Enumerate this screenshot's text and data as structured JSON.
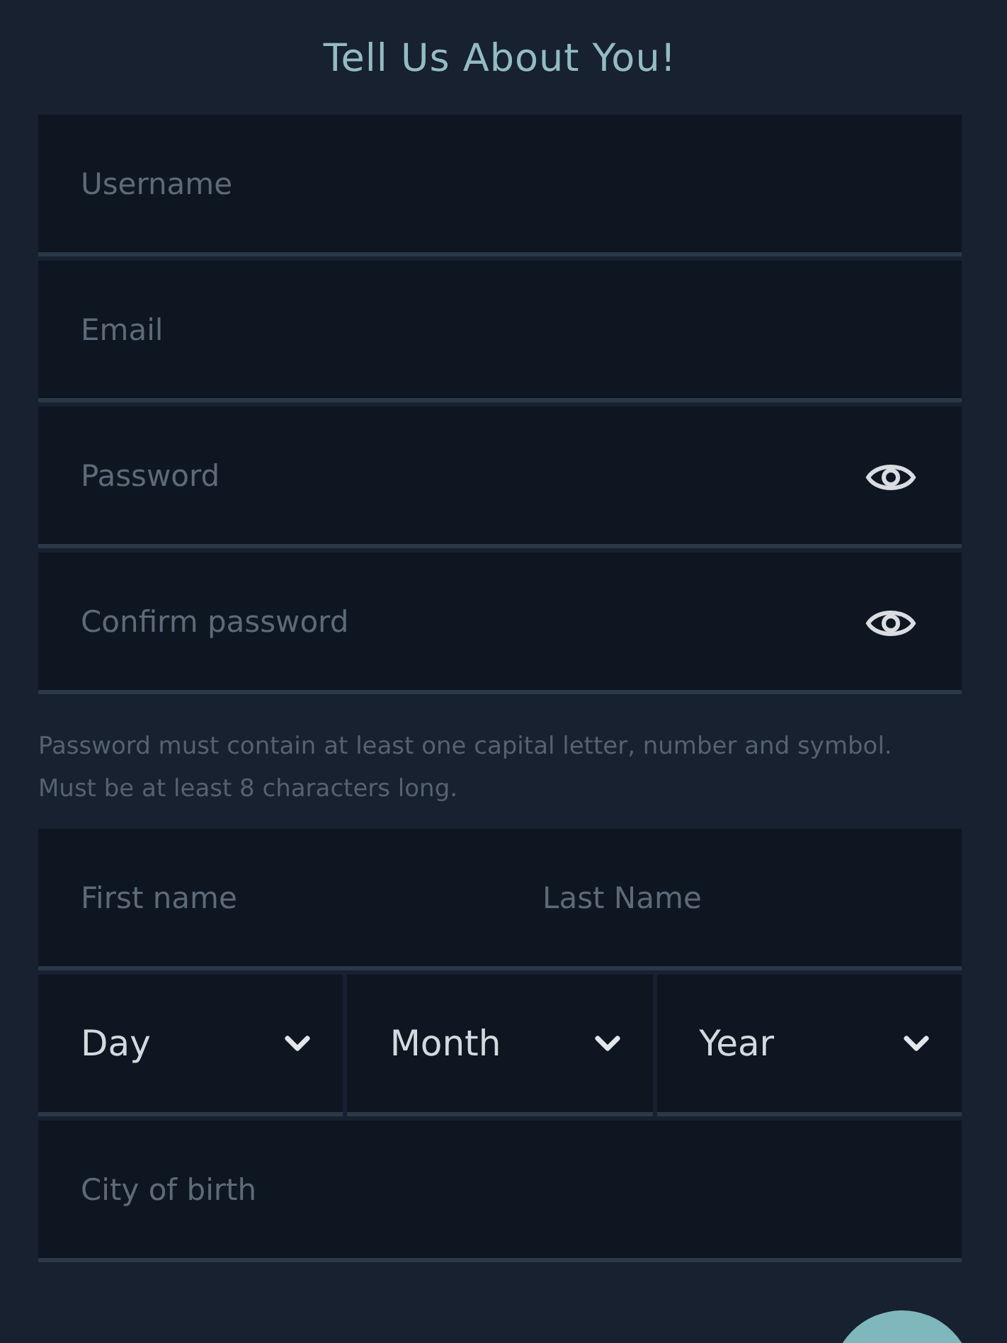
{
  "title": "Tell Us About You!",
  "account_fields": [
    {
      "kind": "text",
      "placeholder": "Username"
    },
    {
      "kind": "text",
      "placeholder": "Email"
    },
    {
      "kind": "password",
      "placeholder": "Password"
    },
    {
      "kind": "password",
      "placeholder": "Confirm password"
    }
  ],
  "password_hint": "Password must contain at least one capital letter, number and symbol. Must be at least 8 characters long.",
  "personal": {
    "name_fields": [
      {
        "placeholder": "First name"
      },
      {
        "placeholder": "Last Name"
      }
    ],
    "date_selects": [
      {
        "value": "Day"
      },
      {
        "value": "Month"
      },
      {
        "value": "Year"
      }
    ],
    "city_field": {
      "placeholder": "City of birth"
    }
  }
}
